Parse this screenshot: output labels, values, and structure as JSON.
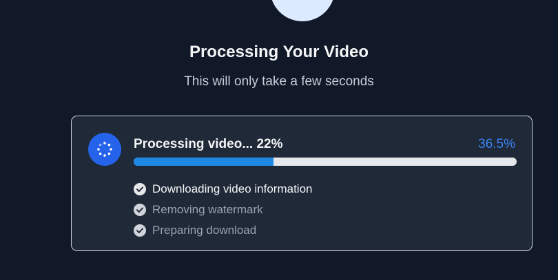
{
  "header": {
    "title": "Processing Your Video",
    "subtitle": "This will only take a few seconds"
  },
  "progress_card": {
    "status_text": "Processing video... 22%",
    "percent_text": "36.5%",
    "progress_fraction": 0.365,
    "steps": [
      {
        "label": "Downloading video information",
        "state": "done"
      },
      {
        "label": "Removing watermark",
        "state": "pending"
      },
      {
        "label": "Preparing download",
        "state": "pending"
      }
    ]
  },
  "colors": {
    "background": "#111827",
    "card": "#1f2937",
    "accent": "#2563eb",
    "progress_fill": "#1e88e5",
    "percent": "#3b82f6",
    "top_circle": "#dbeafe"
  },
  "icons": {
    "spinner": "spinner-icon",
    "check": "check-circle-icon"
  }
}
